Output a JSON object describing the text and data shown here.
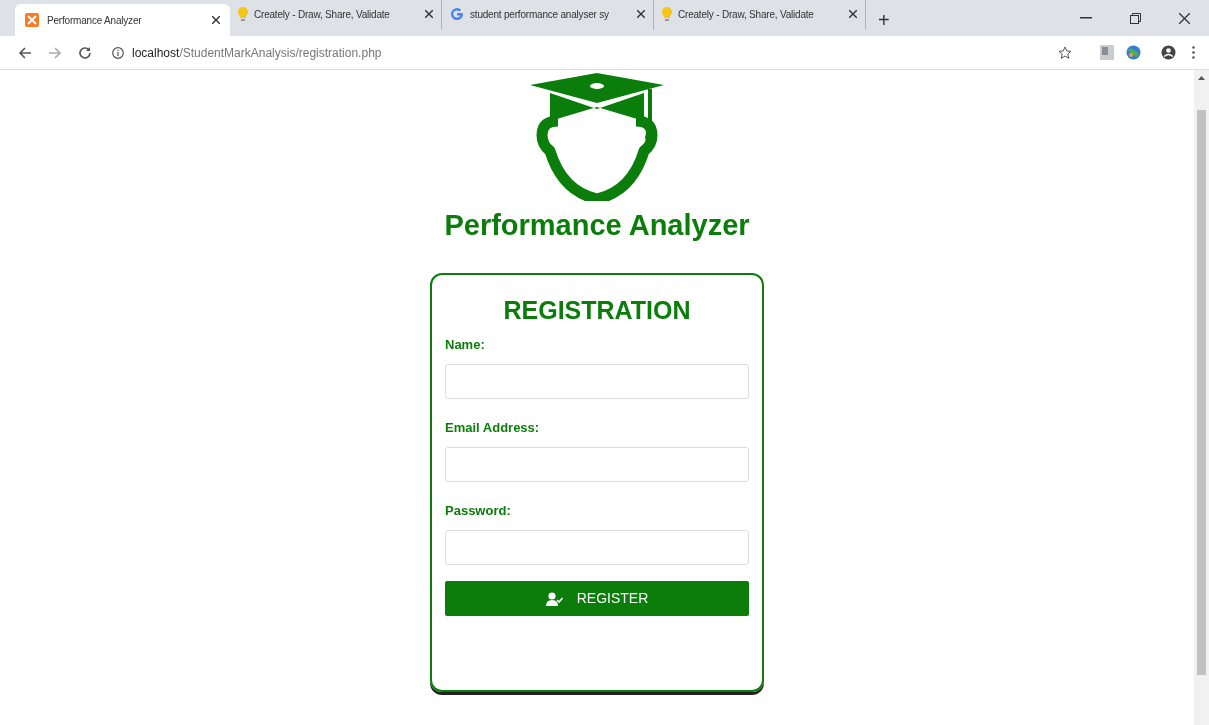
{
  "tabs": [
    {
      "label": "Performance Analyzer",
      "selected": true,
      "kind": "xampp"
    },
    {
      "label": "Creately - Draw, Share, Validate",
      "selected": false,
      "kind": "bulb"
    },
    {
      "label": "student performance analyser sy",
      "selected": false,
      "kind": "google"
    },
    {
      "label": "Creately - Draw, Share, Validate",
      "selected": false,
      "kind": "bulb"
    }
  ],
  "new_tab": "+",
  "address": {
    "host": "localhost",
    "path": "/StudentMarkAnalysis/registration.php"
  },
  "app_title": "Performance Analyzer",
  "form": {
    "heading": "REGISTRATION",
    "fields": [
      {
        "label": "Name:"
      },
      {
        "label": "Email Address:"
      },
      {
        "label": "Password:"
      }
    ],
    "button": "REGISTER"
  }
}
